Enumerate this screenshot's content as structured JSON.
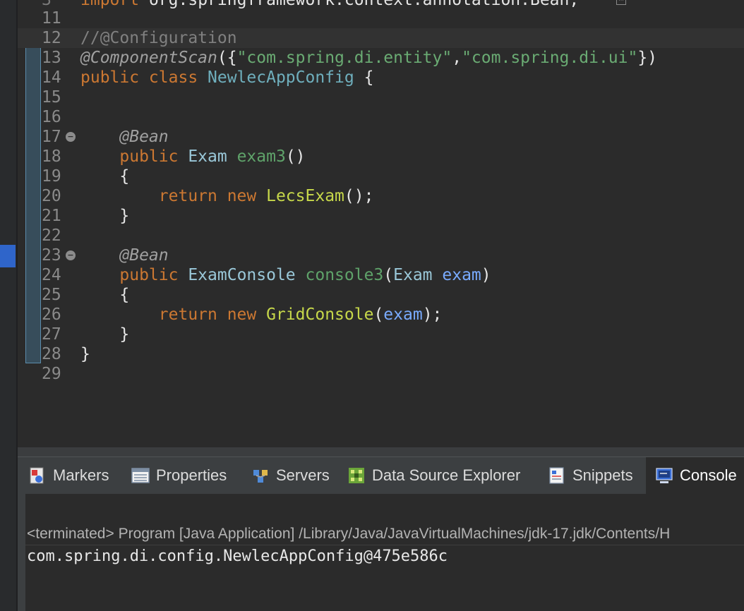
{
  "editor": {
    "partial_top_line": {
      "number": "3",
      "text": "import org.springframework.context.annotation.Bean;"
    },
    "lines": [
      {
        "number": "11",
        "tokens": []
      },
      {
        "number": "12",
        "tokens": [
          {
            "cls": "t-cm",
            "text": "//@Configuration"
          }
        ]
      },
      {
        "number": "13",
        "tokens": [
          {
            "cls": "t-an",
            "text": "@ComponentScan"
          },
          {
            "cls": "t-pl",
            "text": "({"
          },
          {
            "cls": "t-str",
            "text": "\"com.spring.di.entity\""
          },
          {
            "cls": "t-pl",
            "text": ","
          },
          {
            "cls": "t-str",
            "text": "\"com.spring.di.ui\""
          },
          {
            "cls": "t-pl",
            "text": "})"
          }
        ]
      },
      {
        "number": "14",
        "tokens": [
          {
            "cls": "t-kw",
            "text": "public class "
          },
          {
            "cls": "t-cls",
            "text": "NewlecAppConfig"
          },
          {
            "cls": "t-pl",
            "text": " {"
          }
        ]
      },
      {
        "number": "15",
        "tokens": []
      },
      {
        "number": "16",
        "tokens": []
      },
      {
        "number": "17",
        "fold": true,
        "tokens": [
          {
            "cls": "t-pl",
            "text": "    "
          },
          {
            "cls": "t-an",
            "text": "@Bean"
          }
        ]
      },
      {
        "number": "18",
        "tokens": [
          {
            "cls": "t-pl",
            "text": "    "
          },
          {
            "cls": "t-kw",
            "text": "public "
          },
          {
            "cls": "t-type",
            "text": "Exam "
          },
          {
            "cls": "t-meth",
            "text": "exam3"
          },
          {
            "cls": "t-pl",
            "text": "()"
          }
        ]
      },
      {
        "number": "19",
        "tokens": [
          {
            "cls": "t-pl",
            "text": "    {"
          }
        ]
      },
      {
        "number": "20",
        "tokens": [
          {
            "cls": "t-pl",
            "text": "        "
          },
          {
            "cls": "t-kw",
            "text": "return new "
          },
          {
            "cls": "t-ctor",
            "text": "LecsExam"
          },
          {
            "cls": "t-pl",
            "text": "();"
          }
        ]
      },
      {
        "number": "21",
        "tokens": [
          {
            "cls": "t-pl",
            "text": "    }"
          }
        ]
      },
      {
        "number": "22",
        "tokens": []
      },
      {
        "number": "23",
        "fold": true,
        "tokens": [
          {
            "cls": "t-pl",
            "text": "    "
          },
          {
            "cls": "t-an",
            "text": "@Bean"
          }
        ]
      },
      {
        "number": "24",
        "tokens": [
          {
            "cls": "t-pl",
            "text": "    "
          },
          {
            "cls": "t-kw",
            "text": "public "
          },
          {
            "cls": "t-type",
            "text": "ExamConsole "
          },
          {
            "cls": "t-meth",
            "text": "console3"
          },
          {
            "cls": "t-pl",
            "text": "("
          },
          {
            "cls": "t-type",
            "text": "Exam "
          },
          {
            "cls": "t-param",
            "text": "exam"
          },
          {
            "cls": "t-pl",
            "text": ")"
          }
        ]
      },
      {
        "number": "25",
        "tokens": [
          {
            "cls": "t-pl",
            "text": "    {"
          }
        ]
      },
      {
        "number": "26",
        "tokens": [
          {
            "cls": "t-pl",
            "text": "        "
          },
          {
            "cls": "t-kw",
            "text": "return new "
          },
          {
            "cls": "t-ctor",
            "text": "GridConsole"
          },
          {
            "cls": "t-pl",
            "text": "("
          },
          {
            "cls": "t-param",
            "text": "exam"
          },
          {
            "cls": "t-pl",
            "text": ");"
          }
        ]
      },
      {
        "number": "27",
        "tokens": [
          {
            "cls": "t-pl",
            "text": "    }"
          }
        ]
      },
      {
        "number": "28",
        "tokens": [
          {
            "cls": "t-pl",
            "text": "}"
          }
        ]
      },
      {
        "number": "29",
        "tokens": []
      }
    ],
    "current_line": "12",
    "fold_icon": "collapse-icon"
  },
  "bottom_panel": {
    "tabs": [
      {
        "label": "Markers",
        "icon": "markers-icon"
      },
      {
        "label": "Properties",
        "icon": "properties-icon"
      },
      {
        "label": "Servers",
        "icon": "servers-icon"
      },
      {
        "label": "Data Source Explorer",
        "icon": "data-source-explorer-icon"
      },
      {
        "label": "Snippets",
        "icon": "snippets-icon"
      },
      {
        "label": "Console",
        "icon": "console-icon",
        "active": true
      }
    ],
    "console": {
      "status": "<terminated> Program [Java Application] /Library/Java/JavaVirtualMachines/jdk-17.jdk/Contents/H",
      "output": "com.spring.di.config.NewlecAppConfig@475e586c"
    }
  },
  "colors": {
    "editor_bg": "#2b2b2b",
    "keyword": "#cc7832",
    "string": "#6aab73",
    "class_name": "#6fafbd",
    "active_tab_bg": "#2b2b2b",
    "selection_marker": "#2f65ca"
  }
}
